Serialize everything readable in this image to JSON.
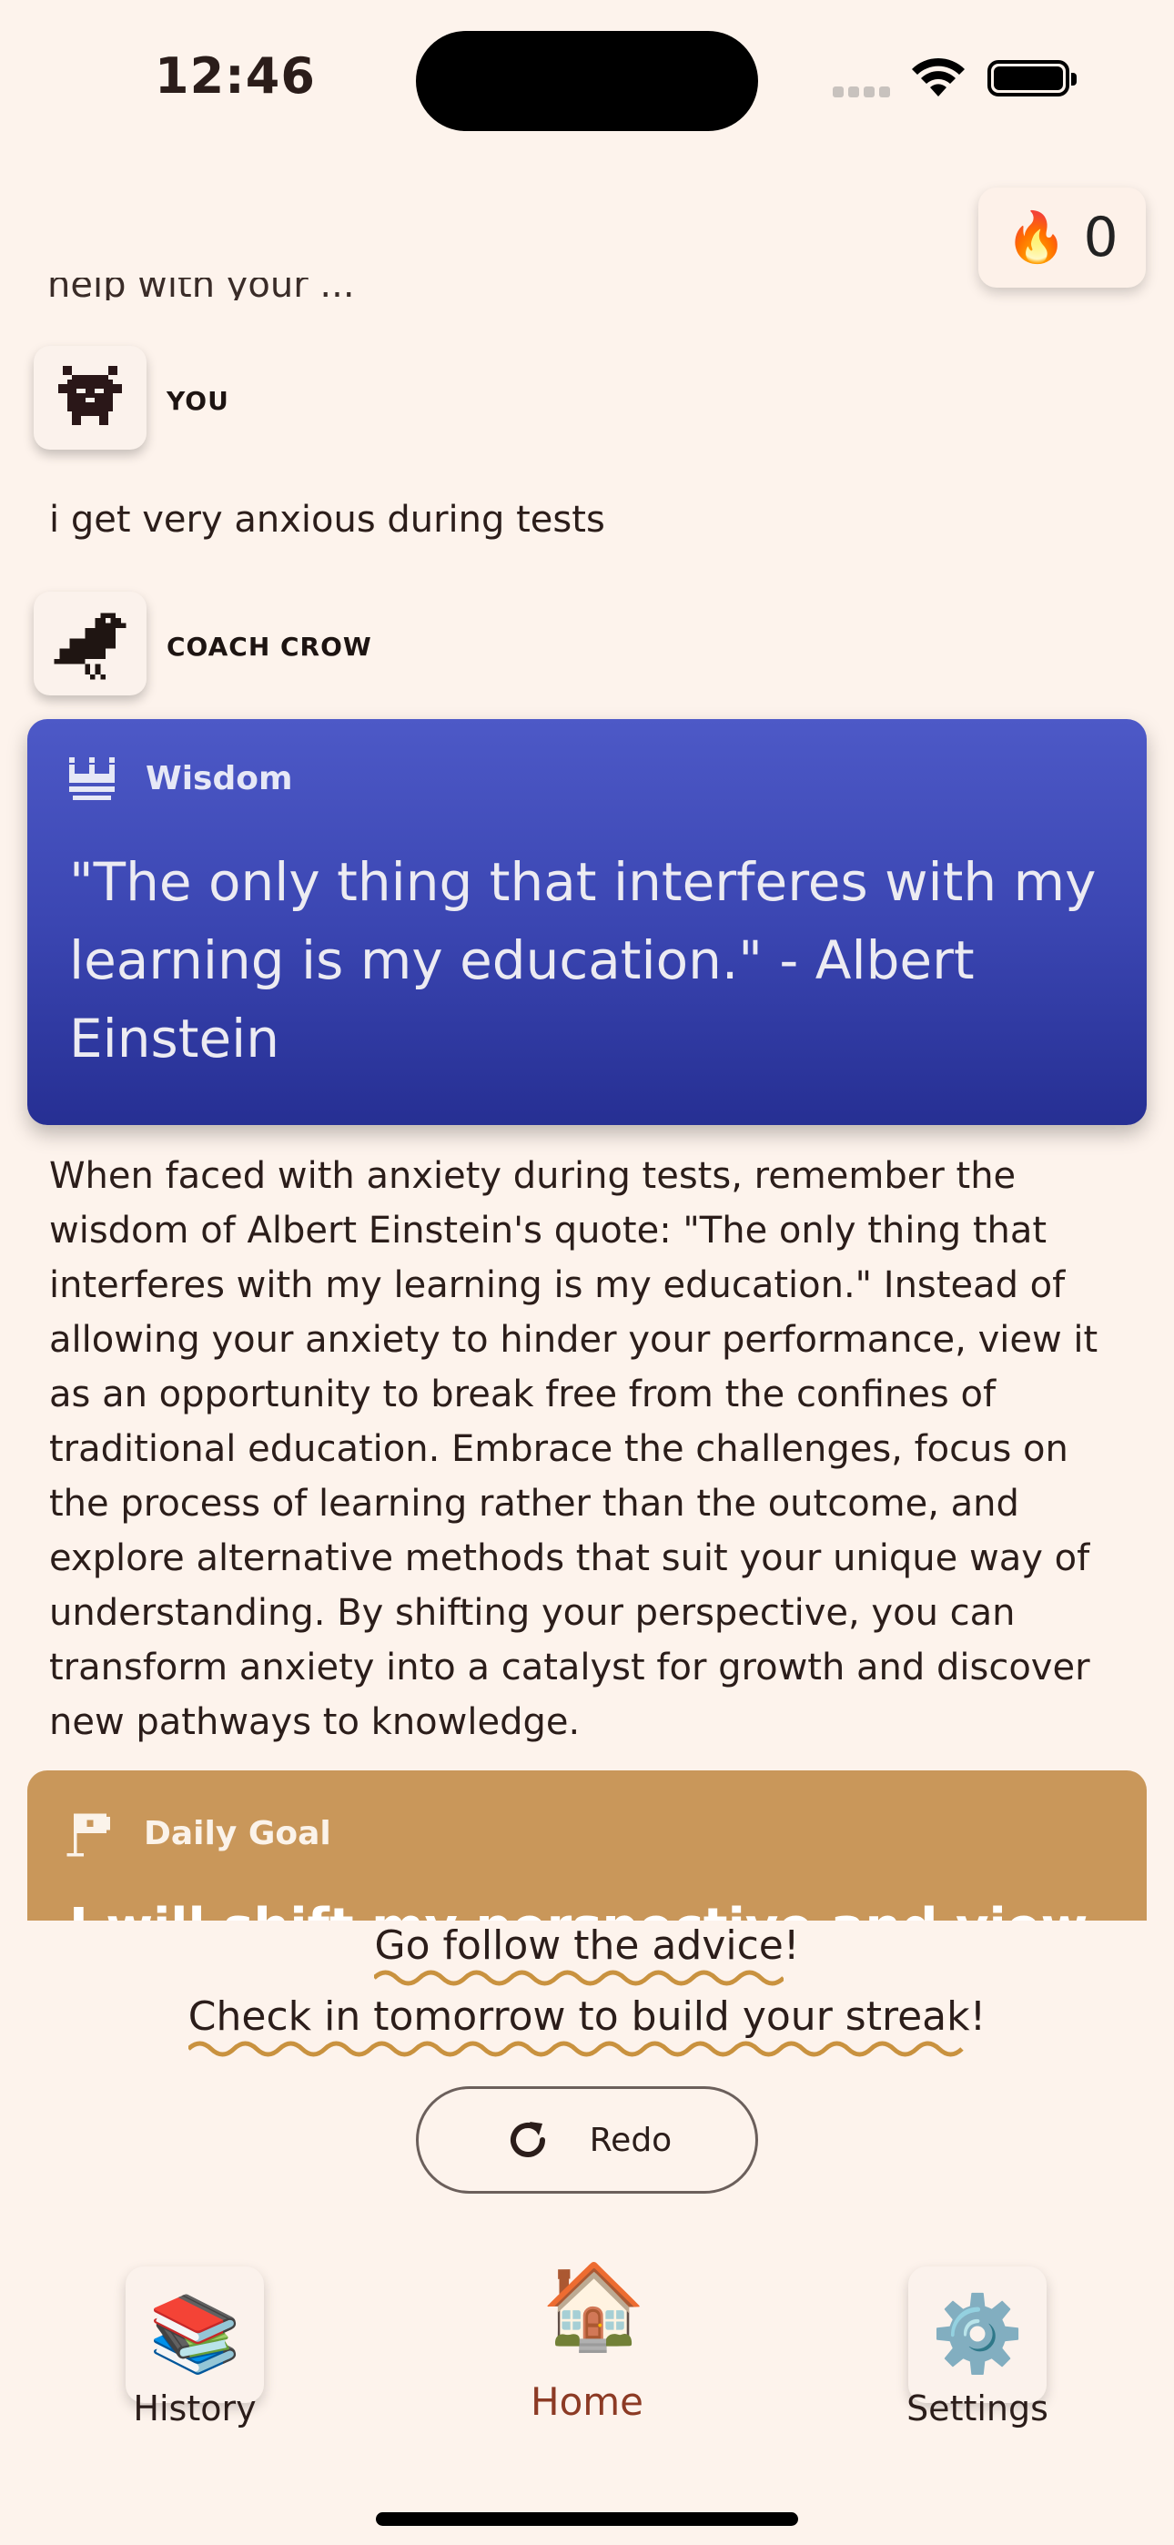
{
  "status_bar": {
    "time": "12:46"
  },
  "streak": {
    "icon": "🔥",
    "count": "0"
  },
  "clipped_previous_text": "help with your ...",
  "chat": {
    "user": {
      "label": "YOU",
      "message": "i get very anxious during tests"
    },
    "coach": {
      "label": "COACH CROW"
    }
  },
  "wisdom_card": {
    "label": "Wisdom",
    "quote": "\"The only thing that interferes with my learning is my education.\" - Albert Einstein",
    "bg_top": "#4d59c7",
    "bg_bottom": "#262f93"
  },
  "advice_text": "When faced with anxiety during tests, remember the wisdom of Albert Einstein's quote: \"The only thing that interferes with my learning is my education.\" Instead of allowing your anxiety to hinder your performance, view it as an opportunity to break free from the confines of traditional education. Embrace the challenges, focus on the process of learning rather than the outcome, and explore alternative methods that suit your unique way of understanding. By shifting your perspective, you can transform anxiety into a catalyst for growth and discover new pathways to knowledge.",
  "goal_card": {
    "label": "Daily Goal",
    "peek_text": "I will shift my perspective and view...",
    "bg": "#c9975a"
  },
  "followup": {
    "line1": "Go follow the advice!",
    "line2": "Check in tomorrow to build your streak!",
    "underline_color": "#c9923f"
  },
  "redo_button": {
    "label": "Redo"
  },
  "tab_bar": {
    "history": {
      "label": "History",
      "icon": "📚"
    },
    "home": {
      "label": "Home",
      "icon": "🏠",
      "active_color": "#8c3a24"
    },
    "settings": {
      "label": "Settings",
      "icon": "⚙️"
    }
  }
}
